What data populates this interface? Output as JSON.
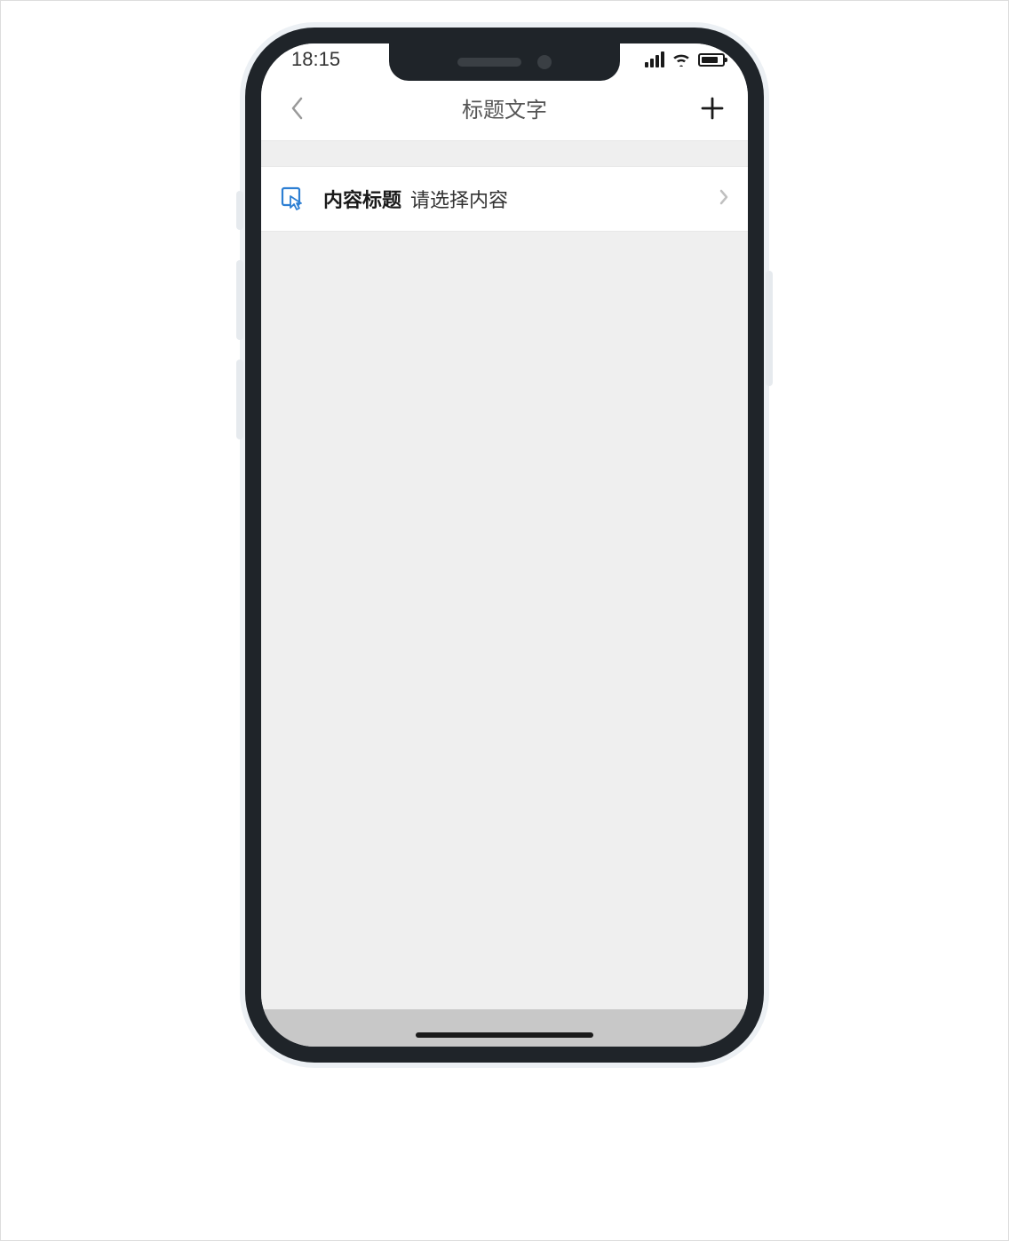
{
  "status_bar": {
    "time": "18:15"
  },
  "nav": {
    "title": "标题文字"
  },
  "list": {
    "item": {
      "title": "内容标题",
      "placeholder": "请选择内容"
    }
  }
}
